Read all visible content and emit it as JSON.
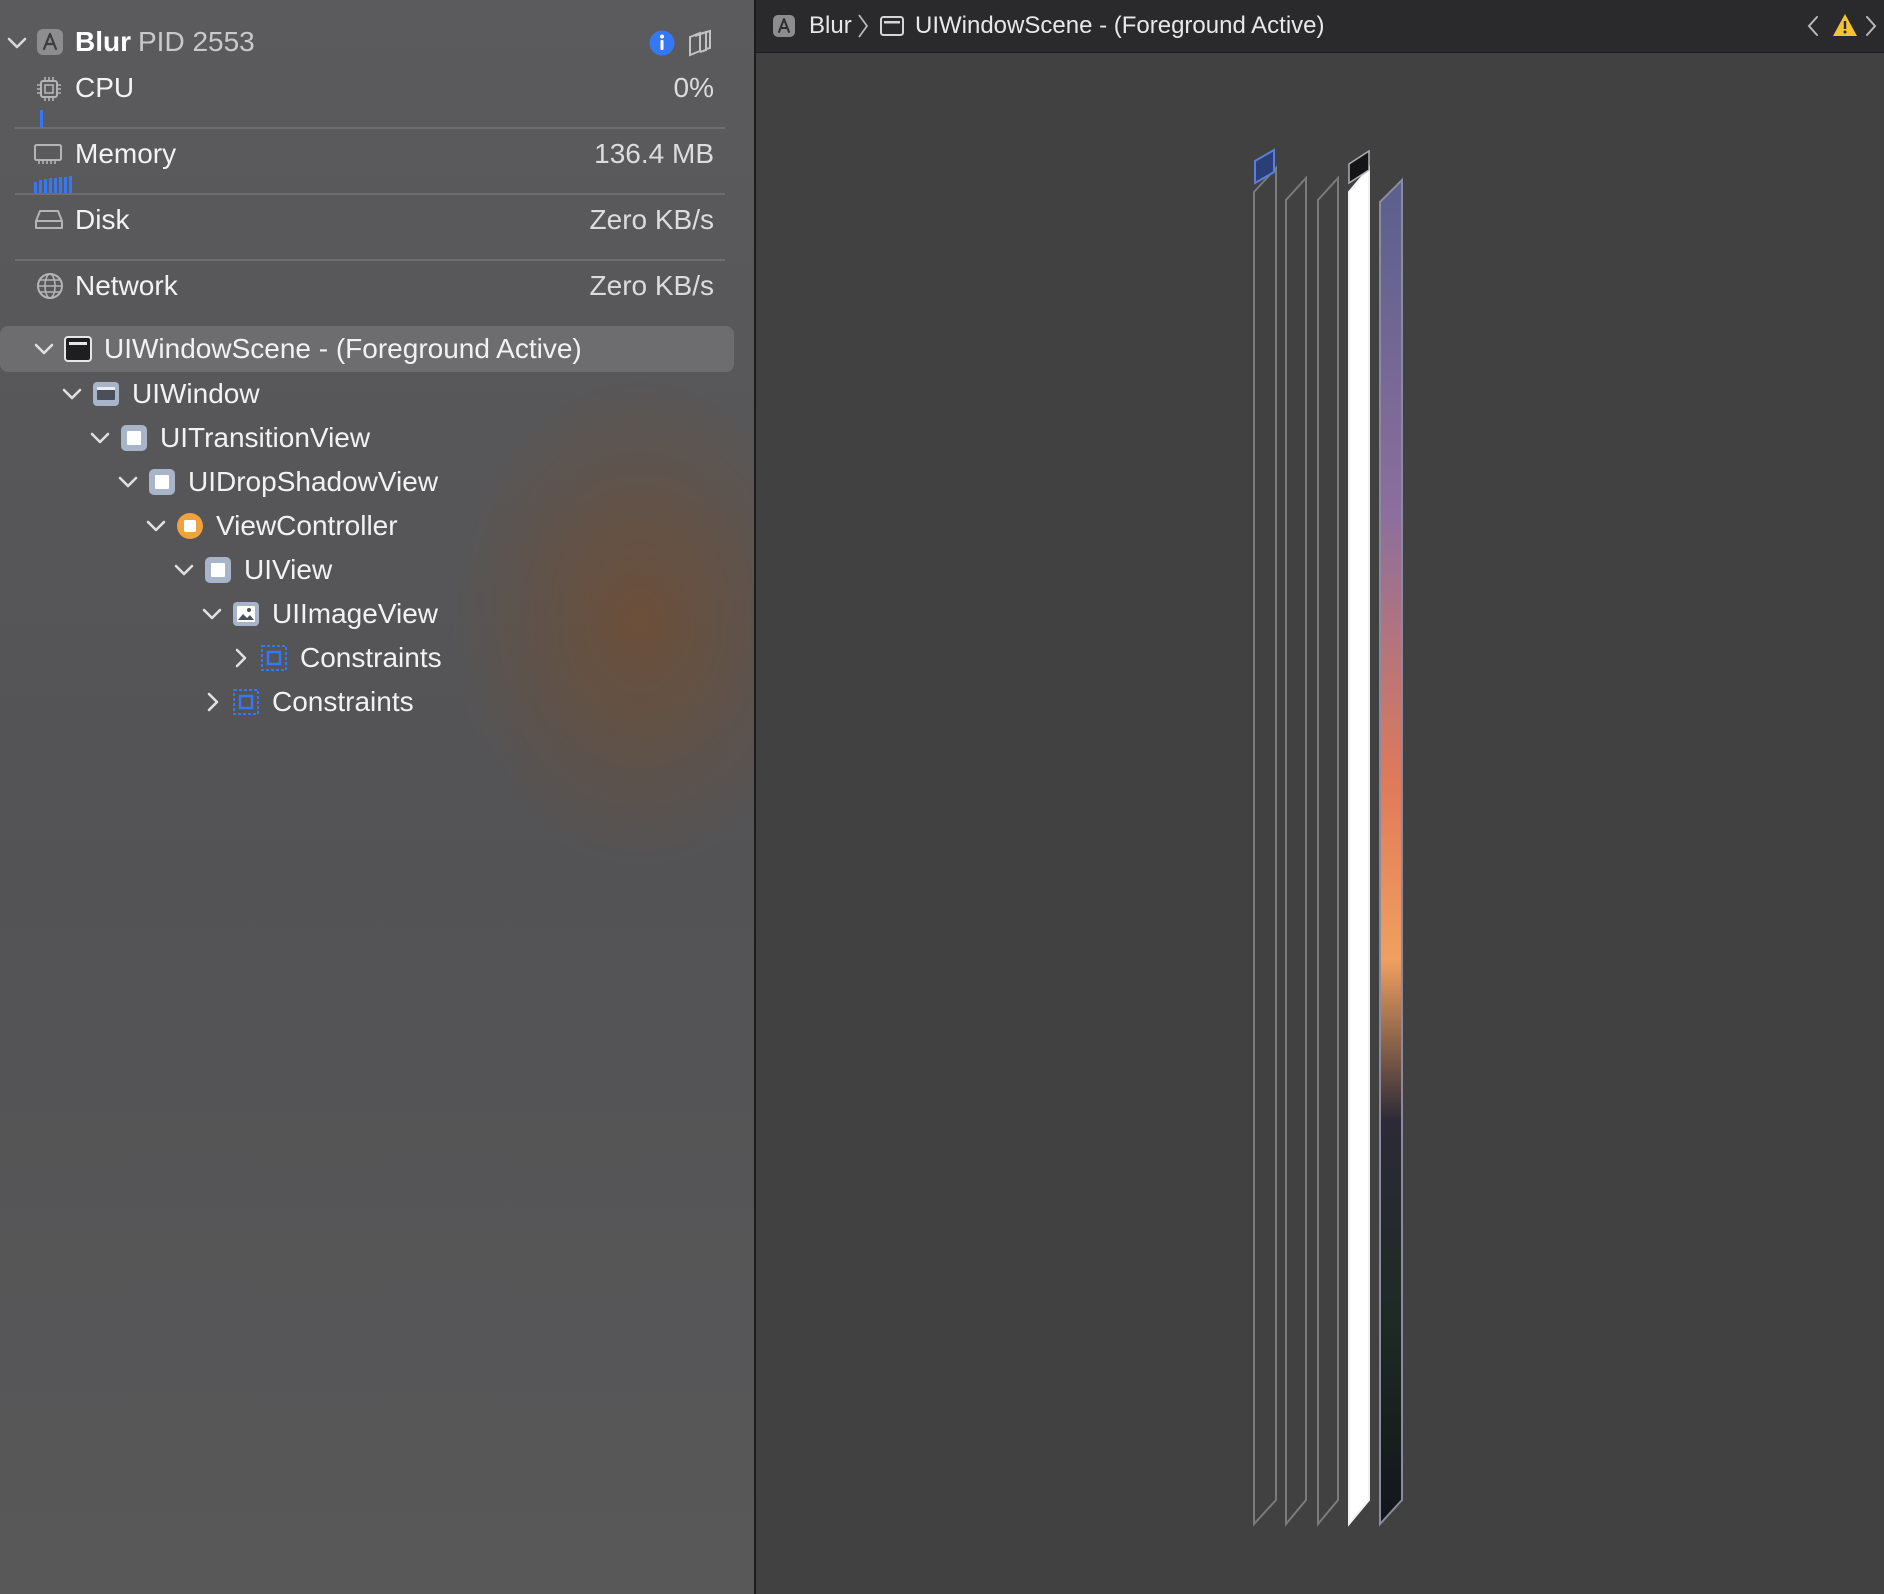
{
  "process": {
    "name": "Blur",
    "pid_label": "PID 2553"
  },
  "metrics": [
    {
      "label": "CPU",
      "value": "0%",
      "icon": "cpu-icon"
    },
    {
      "label": "Memory",
      "value": "136.4 MB",
      "icon": "memory-icon"
    },
    {
      "label": "Disk",
      "value": "Zero KB/s",
      "icon": "disk-icon"
    },
    {
      "label": "Network",
      "value": "Zero KB/s",
      "icon": "network-icon"
    }
  ],
  "tree": [
    {
      "label": "UIWindowScene - (Foreground Active)",
      "icon": "window-scene-icon",
      "expanded": true
    },
    {
      "label": "UIWindow",
      "icon": "window-icon",
      "expanded": true
    },
    {
      "label": "UITransitionView",
      "icon": "view-icon",
      "expanded": true
    },
    {
      "label": "UIDropShadowView",
      "icon": "view-icon",
      "expanded": true
    },
    {
      "label": "ViewController",
      "icon": "view-controller-icon",
      "expanded": true
    },
    {
      "label": "UIView",
      "icon": "view-icon",
      "expanded": true
    },
    {
      "label": "UIImageView",
      "icon": "image-view-icon",
      "expanded": true
    },
    {
      "label": "Constraints",
      "icon": "constraints-icon",
      "expanded": false
    },
    {
      "label": "Constraints",
      "icon": "constraints-icon",
      "expanded": false
    }
  ],
  "breadcrumb": {
    "app": "Blur",
    "scene": "UIWindowScene - (Foreground Active)"
  },
  "colors": {
    "accent_blue": "#3478f6",
    "view_controller_orange": "#f0a33c",
    "warning_yellow": "#f4c430"
  }
}
